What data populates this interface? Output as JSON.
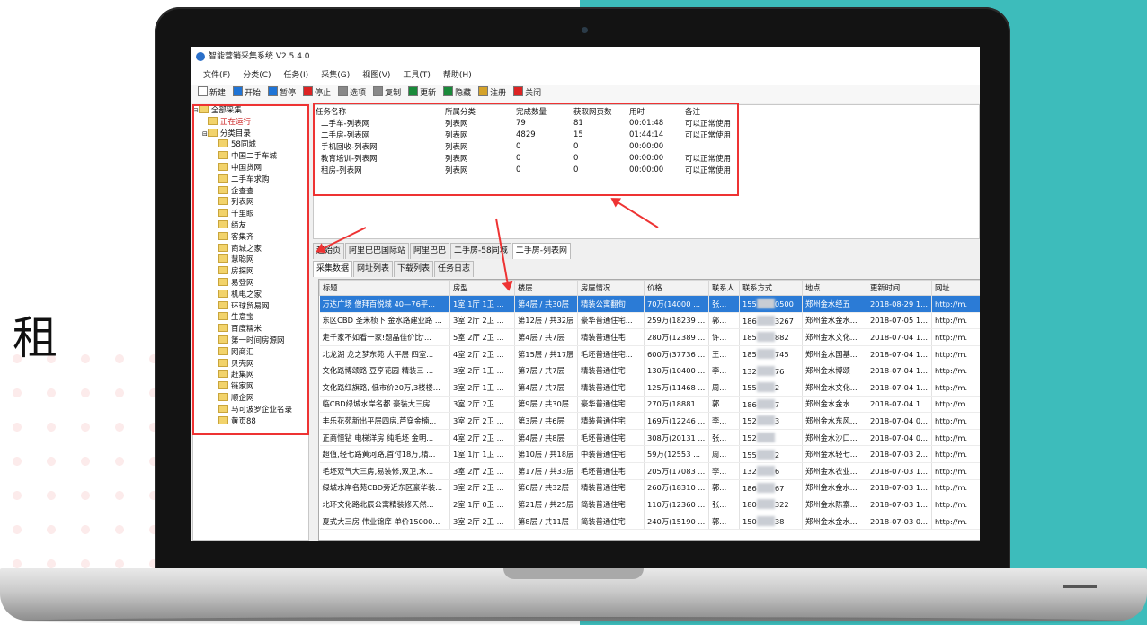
{
  "background": {
    "side_char": "租",
    "teal": "#3dbcbb",
    "highlight_red": "#e33333"
  },
  "window": {
    "title": "智能营销采集系统 V2.5.4.0"
  },
  "menu": [
    "文件(F)",
    "分类(C)",
    "任务(I)",
    "采集(G)",
    "视图(V)",
    "工具(T)",
    "帮助(H)"
  ],
  "toolbar": [
    {
      "label": "新建",
      "icon": "new-doc-icon"
    },
    {
      "label": "开始",
      "icon": "play-icon"
    },
    {
      "label": "暂停",
      "icon": "pause-icon"
    },
    {
      "label": "停止",
      "icon": "stop-icon"
    },
    {
      "label": "选项",
      "icon": "options-icon"
    },
    {
      "label": "复制",
      "icon": "copy-icon"
    },
    {
      "label": "更新",
      "icon": "refresh-icon"
    },
    {
      "label": "隐藏",
      "icon": "hide-icon"
    },
    {
      "label": "注册",
      "icon": "key-icon"
    },
    {
      "label": "关闭",
      "icon": "close-icon"
    }
  ],
  "tree": {
    "root": "全部采集",
    "running": "正在运行",
    "category": "分类目录",
    "items": [
      "58同城",
      "中国二手车城",
      "中国货网",
      "二手车求购",
      "企查查",
      "列表网",
      "千里眼",
      "缔友",
      "客集齐",
      "商城之家",
      "慧聪网",
      "房探网",
      "易登网",
      "机电之家",
      "环球贸易网",
      "生意宝",
      "百度糯米",
      "第一时间房源网",
      "网商汇",
      "贝壳网",
      "赶集网",
      "链家网",
      "顺企网",
      "马可波罗企业名录",
      "黄页88"
    ]
  },
  "tasks": {
    "headers": [
      "任务名称",
      "所属分类",
      "完成数量",
      "获取网页数",
      "用时",
      "备注"
    ],
    "rows": [
      [
        "二手车-列表网",
        "列表网",
        "79",
        "81",
        "00:01:48",
        "可以正常使用"
      ],
      [
        "二手房-列表网",
        "列表网",
        "4829",
        "15",
        "01:44:14",
        "可以正常使用"
      ],
      [
        "手机回收-列表网",
        "列表网",
        "0",
        "0",
        "00:00:00",
        ""
      ],
      [
        "教育培训-列表网",
        "列表网",
        "0",
        "0",
        "00:00:00",
        "可以正常使用"
      ],
      [
        "租房-列表网",
        "列表网",
        "0",
        "0",
        "00:00:00",
        "可以正常使用"
      ]
    ]
  },
  "tabs_top": [
    "起始页",
    "阿里巴巴国际站",
    "阿里巴巴",
    "二手房-58同城",
    "二手房-列表网"
  ],
  "tabs_top_active": "二手房-列表网",
  "tabs_sub": [
    "采集数据",
    "网址列表",
    "下载列表",
    "任务日志"
  ],
  "tabs_sub_active": "采集数据",
  "grid": {
    "headers": [
      "标题",
      "房型",
      "楼层",
      "房屋情况",
      "价格",
      "联系人",
      "联系方式",
      "地点",
      "更新时间",
      "网址"
    ],
    "rows": [
      [
        "万达广场 僧拜百悦城 40—76平...",
        "1室 1厅 1卫 ...",
        "第4层 / 共30层",
        "精装公寓翻旬",
        "70万(14000 ...",
        "张...",
        "155",
        "0500",
        "郑州金水经五",
        "2018-08-29 1...",
        "http://m."
      ],
      [
        "东区CBD 圣米桢下 金水路建业路 ...",
        "3室 2厅 2卫 ...",
        "第12层 / 共32层",
        "豪华普通住宅...",
        "259万(18239 ...",
        "郭...",
        "186",
        "3267",
        "郑州金水金水...",
        "2018-07-05 1...",
        "http://m."
      ],
      [
        "走千家不如看一家!题晶佳价比'...",
        "5室 2厅 2卫 ...",
        "第4层 / 共7层",
        "精装普通住宅",
        "280万(12389 ...",
        "许...",
        "185",
        "882",
        "郑州金水文化...",
        "2018-07-04 1...",
        "http://m."
      ],
      [
        "北龙湖 龙之梦东苑 大平层 四室...",
        "4室 2厅 2卫 ...",
        "第15层 / 共17层",
        "毛坯普通住宅...",
        "600万(37736 ...",
        "王...",
        "185",
        "745",
        "郑州金水国基...",
        "2018-07-04 1...",
        "http://m."
      ],
      [
        "文化路博颂路 豆亨花园 精装三 ...",
        "3室 2厅 1卫 ...",
        "第7层 / 共7层",
        "精装普通住宅",
        "130万(10400 ...",
        "李...",
        "132",
        "76",
        "郑州金水博颂",
        "2018-07-04 1...",
        "http://m."
      ],
      [
        "文化路红旗路, 低市价20万,3楼楼...",
        "3室 2厅 1卫 ...",
        "第4层 / 共7层",
        "精装普通住宅",
        "125万(11468 ...",
        "周...",
        "155",
        "2",
        "郑州金水文化...",
        "2018-07-04 1...",
        "http://m."
      ],
      [
        "临CBD绿城水岸名都 豪装大三房 ...",
        "3室 2厅 2卫 ...",
        "第9层 / 共30层",
        "豪华普通住宅",
        "270万(18881 ...",
        "郭...",
        "186",
        "7",
        "郑州金水金水...",
        "2018-07-04 1...",
        "http://m."
      ],
      [
        "丰乐花苑新出平层四房,芦穿金楠...",
        "3室 2厅 2卫 ...",
        "第3层 / 共6层",
        "精装普通住宅",
        "169万(12246 ...",
        "李...",
        "152",
        "3",
        "郑州金水东风...",
        "2018-07-04 0...",
        "http://m."
      ],
      [
        "正商恒钻 电梯洋房 纯毛坯 金明...",
        "4室 2厅 2卫 ...",
        "第4层 / 共8层",
        "毛坯普通住宅",
        "308万(20131 ...",
        "张...",
        "152",
        "",
        "郑州金水沙口...",
        "2018-07-04 0...",
        "http://m."
      ],
      [
        "超值,轻七路黄河路,首付18万,精...",
        "1室 1厅 1卫 ...",
        "第10层 / 共18层",
        "中装普通住宅",
        "59万(12553 ...",
        "周...",
        "155",
        "2",
        "郑州金水轻七...",
        "2018-07-03 2...",
        "http://m."
      ],
      [
        "毛坯双气大三房,易装修,双卫,水...",
        "3室 2厅 2卫 ...",
        "第17层 / 共33层",
        "毛坯普通住宅",
        "205万(17083 ...",
        "李...",
        "132",
        "6",
        "郑州金水农业...",
        "2018-07-03 1...",
        "http://m."
      ],
      [
        "绿城水岸名苑CBD旁近东区豪华装...",
        "3室 2厅 2卫 ...",
        "第6层 / 共32层",
        "精装普通住宅",
        "260万(18310 ...",
        "郭...",
        "186",
        "67",
        "郑州金水金水...",
        "2018-07-03 1...",
        "http://m."
      ],
      [
        "北环文化路北辰公寓精装修天然...",
        "2室 1厅 0卫 ...",
        "第21层 / 共25层",
        "简装普通住宅",
        "110万(12360 ...",
        "张...",
        "180",
        "322",
        "郑州金水陈寨...",
        "2018-07-03 1...",
        "http://m."
      ],
      [
        "夏式大三房 伟业锦庠 单价15000...",
        "3室 2厅 2卫 ...",
        "第8层 / 共11层",
        "简装普通住宅",
        "240万(15190 ...",
        "郭...",
        "150",
        "38",
        "郑州金水金水...",
        "2018-07-03 0...",
        "http://m."
      ]
    ]
  }
}
